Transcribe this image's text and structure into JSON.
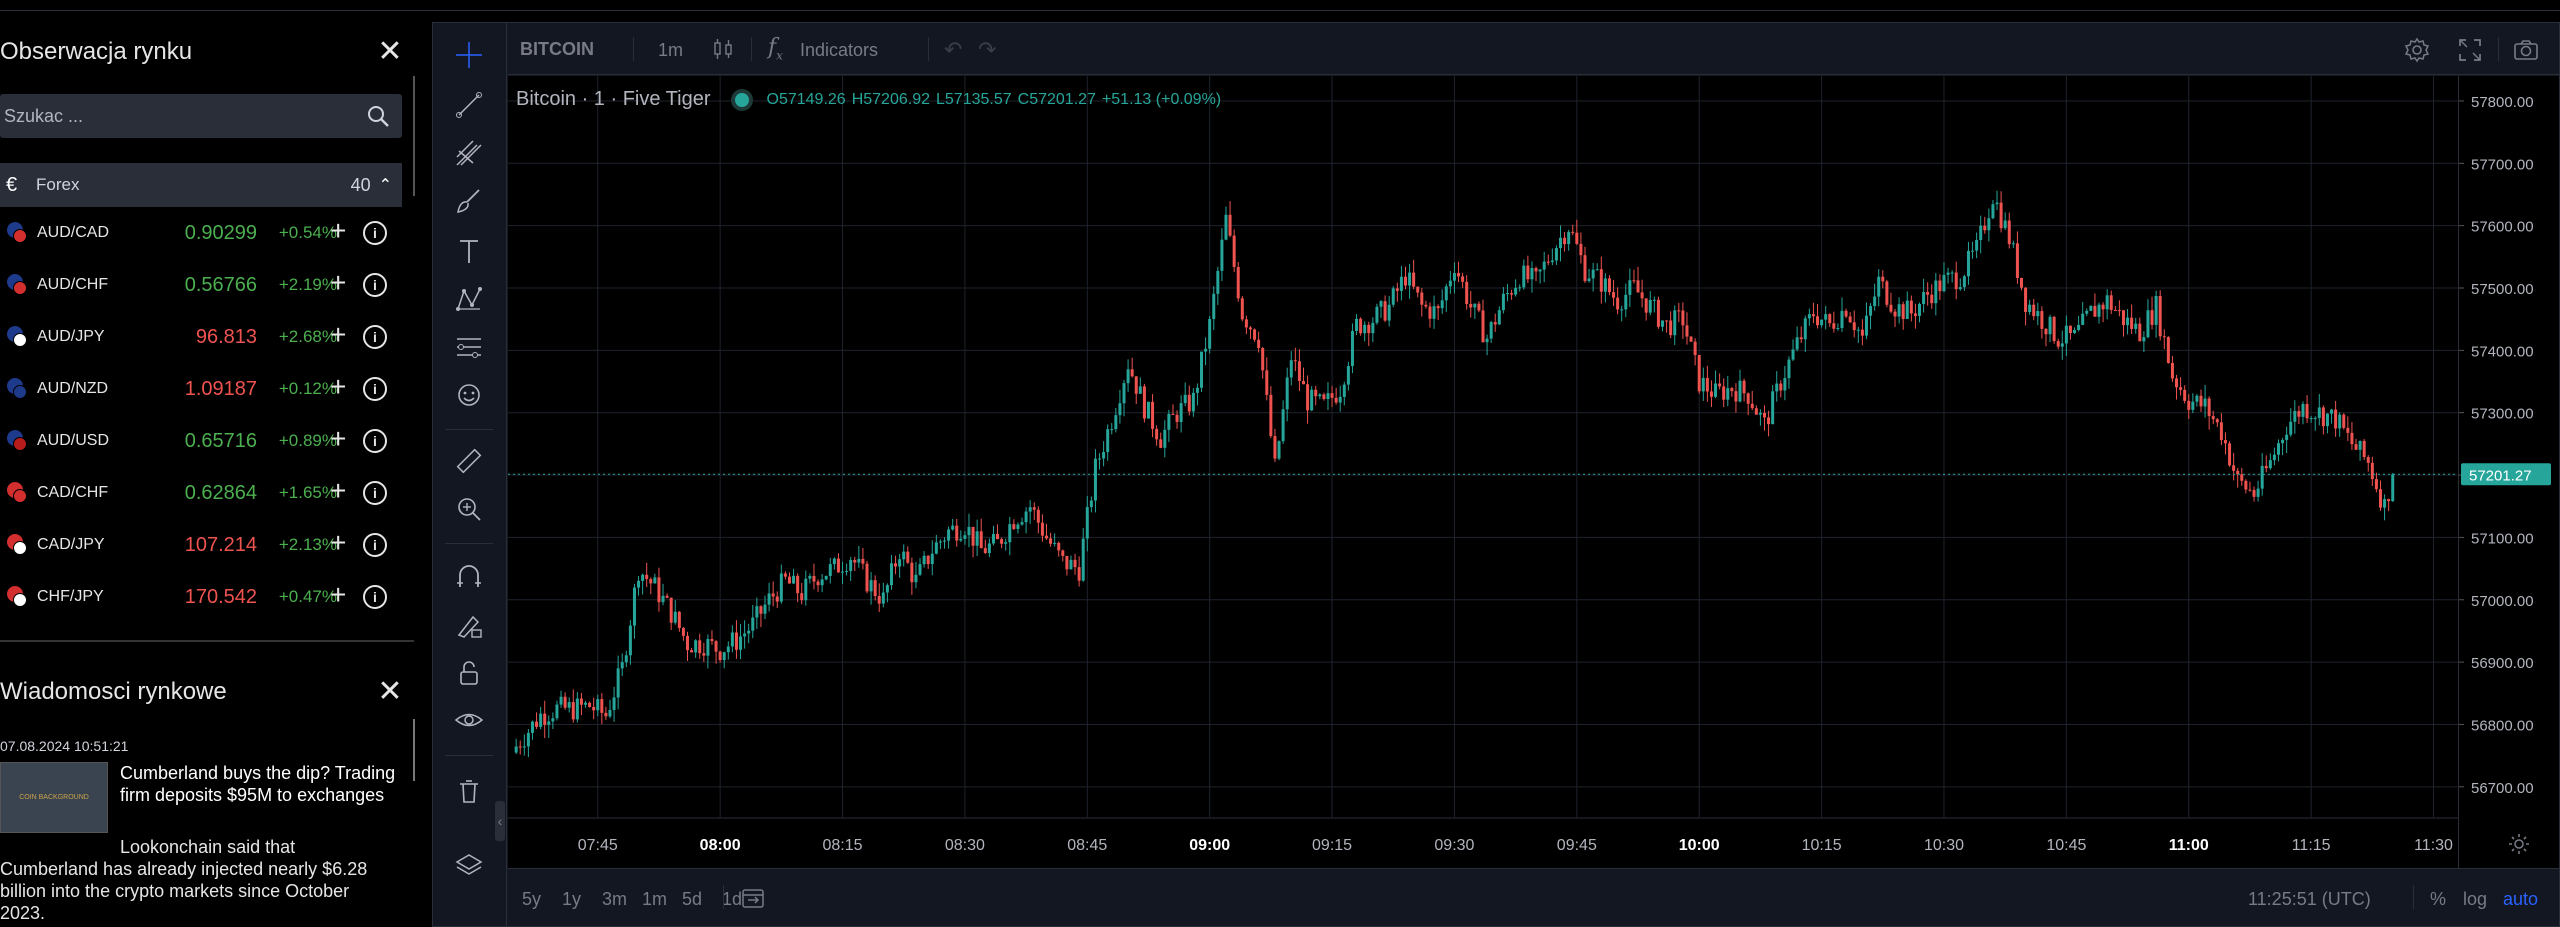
{
  "market_watch": {
    "title": "Obserwacja rynku",
    "search_placeholder": "Szukac ...",
    "category": {
      "icon": "euro-icon",
      "name": "Forex",
      "count": "40"
    },
    "instruments": [
      {
        "symbol": "AUD/CAD",
        "price": "0.90299",
        "change": "+0.54%",
        "direction": "up",
        "flag_colors": [
          "#1e3a8a",
          "#d32f2f"
        ]
      },
      {
        "symbol": "AUD/CHF",
        "price": "0.56766",
        "change": "+2.19%",
        "direction": "up",
        "flag_colors": [
          "#1e3a8a",
          "#d32f2f"
        ]
      },
      {
        "symbol": "AUD/JPY",
        "price": "96.813",
        "change": "+2.68%",
        "direction": "down",
        "flag_colors": [
          "#1e3a8a",
          "#ffffff"
        ]
      },
      {
        "symbol": "AUD/NZD",
        "price": "1.09187",
        "change": "+0.12%",
        "direction": "down",
        "flag_colors": [
          "#1e3a8a",
          "#1e3a8a"
        ]
      },
      {
        "symbol": "AUD/USD",
        "price": "0.65716",
        "change": "+0.89%",
        "direction": "up",
        "flag_colors": [
          "#1e3a8a",
          "#b71c1c"
        ]
      },
      {
        "symbol": "CAD/CHF",
        "price": "0.62864",
        "change": "+1.65%",
        "direction": "up",
        "flag_colors": [
          "#d32f2f",
          "#d32f2f"
        ]
      },
      {
        "symbol": "CAD/JPY",
        "price": "107.214",
        "change": "+2.13%",
        "direction": "down",
        "flag_colors": [
          "#d32f2f",
          "#ffffff"
        ]
      },
      {
        "symbol": "CHF/JPY",
        "price": "170.542",
        "change": "+0.47%",
        "direction": "down",
        "flag_colors": [
          "#d32f2f",
          "#ffffff"
        ]
      }
    ]
  },
  "news": {
    "title": "Wiadomosci rynkowe",
    "items": [
      {
        "date": "07.08.2024 10:51:21",
        "headline": "Cumberland buys the dip? Trading firm deposits $95M to exchanges",
        "summary": "Lookonchain said that Cumberland has already injected nearly $6.28 billion into the crypto markets since October 2023.",
        "thumb_text": "COIN BACKGROUND"
      }
    ]
  },
  "chart_toolbar": {
    "symbol": "BITCOIN",
    "interval": "1m",
    "indicators_label": "Indicators"
  },
  "chart_legend": {
    "title": "Bitcoin · 1 · Five Tiger",
    "open": "O57149.26",
    "high": "H57206.92",
    "low": "L57135.57",
    "close": "C57201.27",
    "change": "+51.13 (+0.09%)"
  },
  "bottom_bar": {
    "ranges": [
      "5y",
      "1y",
      "3m",
      "1m",
      "5d",
      "1d"
    ],
    "clock": "11:25:51 (UTC)",
    "percent_label": "%",
    "log_label": "log",
    "auto_label": "auto"
  },
  "colors": {
    "up": "#26a69a",
    "down": "#ef5350",
    "watch_up": "#4caf50",
    "watch_down": "#ef5350",
    "accent": "#2962ff"
  },
  "chart_data": {
    "type": "candlestick",
    "last_price": 57201.27,
    "last_price_label": "57201.27",
    "y_ticks": [
      "57800.00",
      "57700.00",
      "57600.00",
      "57500.00",
      "57400.00",
      "57300.00",
      "57200.00",
      "57100.00",
      "57000.00",
      "56900.00",
      "56800.00",
      "56700.00"
    ],
    "y_tick_values": [
      57800,
      57700,
      57600,
      57500,
      57400,
      57300,
      57200,
      57100,
      57000,
      56900,
      56800,
      56700
    ],
    "ylim": [
      56650,
      57840
    ],
    "x_ticks": [
      {
        "label": "07:45",
        "minute": 465,
        "bold": false
      },
      {
        "label": "08:00",
        "minute": 480,
        "bold": true
      },
      {
        "label": "08:15",
        "minute": 495,
        "bold": false
      },
      {
        "label": "08:30",
        "minute": 510,
        "bold": false
      },
      {
        "label": "08:45",
        "minute": 525,
        "bold": false
      },
      {
        "label": "09:00",
        "minute": 540,
        "bold": true
      },
      {
        "label": "09:15",
        "minute": 555,
        "bold": false
      },
      {
        "label": "09:30",
        "minute": 570,
        "bold": false
      },
      {
        "label": "09:45",
        "minute": 585,
        "bold": false
      },
      {
        "label": "10:00",
        "minute": 600,
        "bold": true
      },
      {
        "label": "10:15",
        "minute": 615,
        "bold": false
      },
      {
        "label": "10:30",
        "minute": 630,
        "bold": false
      },
      {
        "label": "10:45",
        "minute": 645,
        "bold": false
      },
      {
        "label": "11:00",
        "minute": 660,
        "bold": true
      },
      {
        "label": "11:15",
        "minute": 675,
        "bold": false
      },
      {
        "label": "11:30",
        "minute": 690,
        "bold": false
      }
    ],
    "xlim": [
      454,
      693
    ],
    "anchors_close": [
      [
        455,
        56765
      ],
      [
        458,
        56815
      ],
      [
        460,
        56825
      ],
      [
        462,
        56825
      ],
      [
        464,
        56830
      ],
      [
        466,
        56815
      ],
      [
        468,
        56890
      ],
      [
        470,
        57050
      ],
      [
        472,
        57020
      ],
      [
        474,
        56980
      ],
      [
        476,
        56930
      ],
      [
        478,
        56930
      ],
      [
        480,
        56920
      ],
      [
        482,
        56935
      ],
      [
        484,
        56960
      ],
      [
        486,
        57000
      ],
      [
        488,
        57030
      ],
      [
        490,
        57010
      ],
      [
        492,
        57040
      ],
      [
        494,
        57050
      ],
      [
        496,
        57070
      ],
      [
        498,
        57030
      ],
      [
        500,
        57000
      ],
      [
        502,
        57080
      ],
      [
        504,
        57030
      ],
      [
        506,
        57080
      ],
      [
        508,
        57110
      ],
      [
        510,
        57120
      ],
      [
        512,
        57080
      ],
      [
        514,
        57090
      ],
      [
        516,
        57130
      ],
      [
        518,
        57150
      ],
      [
        520,
        57100
      ],
      [
        522,
        57060
      ],
      [
        524,
        57050
      ],
      [
        526,
        57210
      ],
      [
        528,
        57290
      ],
      [
        530,
        57380
      ],
      [
        532,
        57310
      ],
      [
        534,
        57260
      ],
      [
        536,
        57300
      ],
      [
        538,
        57320
      ],
      [
        540,
        57440
      ],
      [
        542,
        57610
      ],
      [
        544,
        57460
      ],
      [
        546,
        57420
      ],
      [
        548,
        57210
      ],
      [
        550,
        57390
      ],
      [
        552,
        57320
      ],
      [
        554,
        57310
      ],
      [
        556,
        57340
      ],
      [
        558,
        57440
      ],
      [
        560,
        57450
      ],
      [
        562,
        57470
      ],
      [
        564,
        57520
      ],
      [
        566,
        57470
      ],
      [
        568,
        57460
      ],
      [
        570,
        57540
      ],
      [
        572,
        57470
      ],
      [
        574,
        57420
      ],
      [
        576,
        57480
      ],
      [
        578,
        57520
      ],
      [
        580,
        57510
      ],
      [
        582,
        57560
      ],
      [
        584,
        57600
      ],
      [
        586,
        57530
      ],
      [
        588,
        57510
      ],
      [
        590,
        57480
      ],
      [
        592,
        57500
      ],
      [
        594,
        57470
      ],
      [
        596,
        57440
      ],
      [
        598,
        57450
      ],
      [
        600,
        57350
      ],
      [
        602,
        57330
      ],
      [
        604,
        57340
      ],
      [
        606,
        57330
      ],
      [
        608,
        57280
      ],
      [
        610,
        57350
      ],
      [
        612,
        57410
      ],
      [
        614,
        57460
      ],
      [
        616,
        57440
      ],
      [
        618,
        57470
      ],
      [
        620,
        57420
      ],
      [
        622,
        57510
      ],
      [
        624,
        57470
      ],
      [
        626,
        57460
      ],
      [
        628,
        57490
      ],
      [
        630,
        57510
      ],
      [
        632,
        57520
      ],
      [
        634,
        57560
      ],
      [
        636,
        57650
      ],
      [
        638,
        57580
      ],
      [
        640,
        57480
      ],
      [
        642,
        57450
      ],
      [
        644,
        57420
      ],
      [
        646,
        57420
      ],
      [
        648,
        57460
      ],
      [
        650,
        57480
      ],
      [
        652,
        57450
      ],
      [
        654,
        57430
      ],
      [
        656,
        57470
      ],
      [
        658,
        57360
      ],
      [
        660,
        57320
      ],
      [
        662,
        57310
      ],
      [
        664,
        57270
      ],
      [
        666,
        57190
      ],
      [
        668,
        57170
      ],
      [
        670,
        57220
      ],
      [
        672,
        57280
      ],
      [
        674,
        57310
      ],
      [
        676,
        57300
      ],
      [
        678,
        57290
      ],
      [
        680,
        57250
      ],
      [
        682,
        57220
      ],
      [
        684,
        57150
      ],
      [
        685,
        57201.27
      ]
    ]
  }
}
